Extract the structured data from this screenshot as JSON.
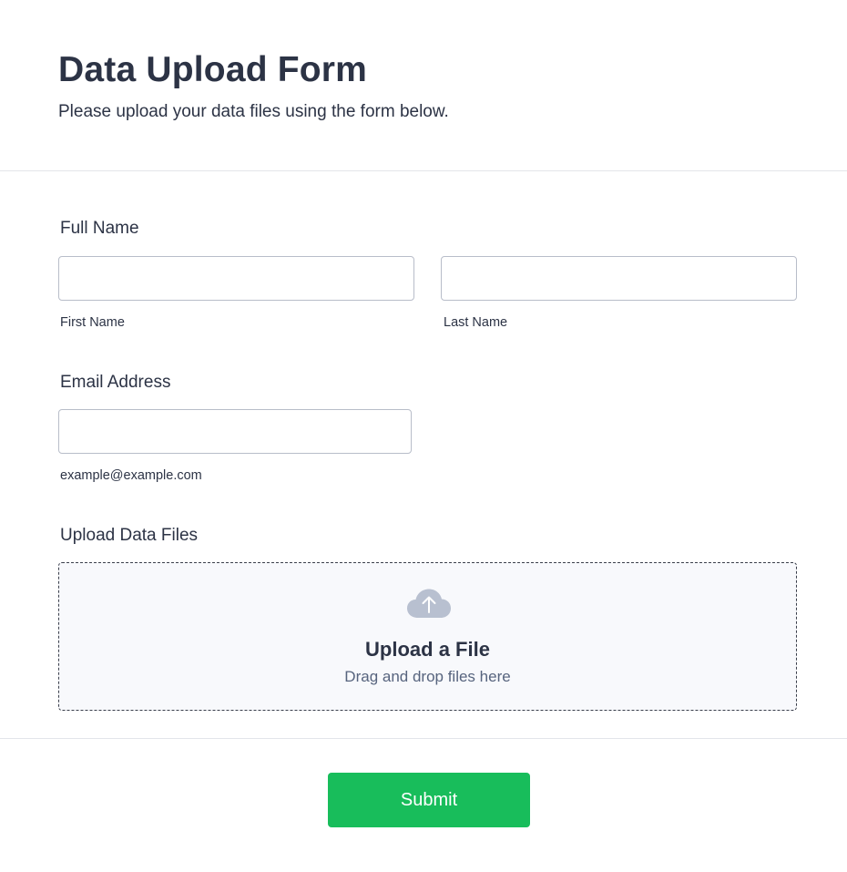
{
  "form": {
    "title": "Data Upload Form",
    "subtitle": "Please upload your data files using the form below."
  },
  "full_name": {
    "label": "Full Name",
    "first": {
      "value": "",
      "placeholder": "",
      "sublabel": "First Name"
    },
    "last": {
      "value": "",
      "placeholder": "",
      "sublabel": "Last Name"
    }
  },
  "email": {
    "label": "Email Address",
    "value": "",
    "placeholder": "",
    "sublabel": "example@example.com"
  },
  "upload": {
    "label": "Upload Data Files",
    "icon": "cloud-upload-icon",
    "title": "Upload a File",
    "hint": "Drag and drop files here"
  },
  "submit": {
    "label": "Submit"
  },
  "colors": {
    "text": "#2c3345",
    "hint": "#57647e",
    "border": "#b8bdc9",
    "divider": "#e3e5ea",
    "dropzone_bg": "#f8f9fc",
    "cloud": "#b8c0d0",
    "submit_bg": "#18bd5b"
  }
}
